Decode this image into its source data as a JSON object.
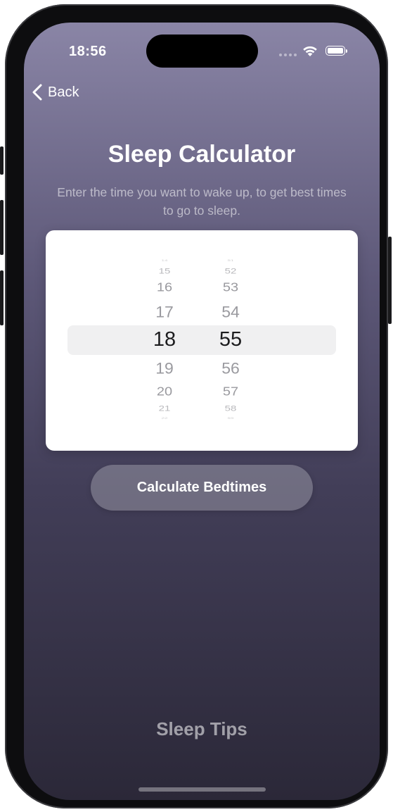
{
  "status": {
    "time": "18:56",
    "icons": [
      "signal-icon",
      "wifi-icon",
      "battery-icon"
    ]
  },
  "nav": {
    "back_label": "Back"
  },
  "header": {
    "title": "Sleep Calculator",
    "subtitle": "Enter the time you want to wake up, to get best times to go to sleep."
  },
  "picker": {
    "selected_hour": "18",
    "selected_minute": "55",
    "hours": [
      "14",
      "15",
      "16",
      "17",
      "18",
      "19",
      "20",
      "21",
      "22"
    ],
    "minutes": [
      "51",
      "52",
      "53",
      "54",
      "55",
      "56",
      "57",
      "58",
      "59"
    ]
  },
  "actions": {
    "calculate_label": "Calculate Bedtimes",
    "tips_label": "Sleep Tips"
  },
  "colors": {
    "gradient_top": "#8a85a6",
    "gradient_bottom": "#2b2838",
    "card": "#ffffff"
  }
}
